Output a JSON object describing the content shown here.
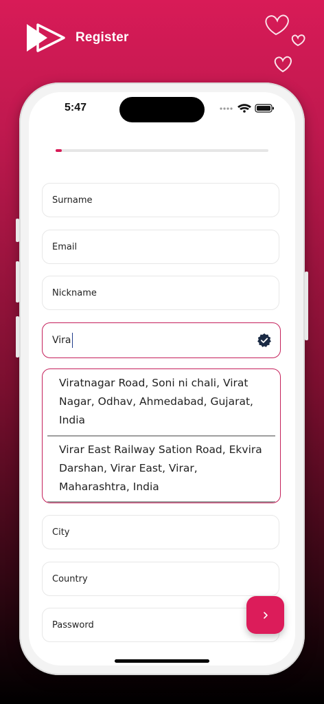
{
  "header": {
    "title": "Register"
  },
  "status_bar": {
    "time": "5:47"
  },
  "progress": {
    "value": 0.03
  },
  "form": {
    "surname_placeholder": "Surname",
    "email_placeholder": "Email",
    "nickname_placeholder": "Nickname",
    "address_value": "Vira",
    "city_placeholder": "City",
    "country_placeholder": "Country",
    "password_placeholder": "Password"
  },
  "suggestions": [
    "Viratnagar Road, Soni ni chali, Virat Nagar, Odhav, Ahmedabad, Gujarat, India",
    "Virar East Railway Sation Road, Ekvira Darshan, Virar East, Virar, Maharashtra, India"
  ],
  "icons": {
    "logo": "play-arrows-logo",
    "decoration": "hearts-icon",
    "verified": "verified-badge-icon",
    "next": "chevron-right-icon"
  },
  "colors": {
    "accent": "#dc1c5a",
    "verified": "#1a2a44"
  }
}
